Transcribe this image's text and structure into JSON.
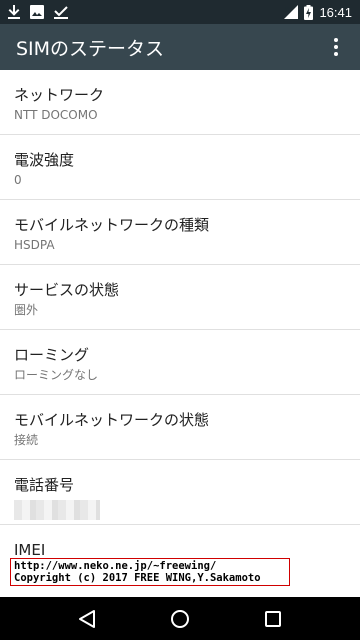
{
  "status_bar": {
    "time": "16:41",
    "signal_label": "H",
    "battery_icon": "battery-charging-icon",
    "left_icons": [
      "download-icon",
      "image-icon",
      "check-icon"
    ]
  },
  "app_bar": {
    "title": "SIMのステータス",
    "overflow_icon": "more-vert-icon",
    "bg_color": "#37474f"
  },
  "items": [
    {
      "title": "ネットワーク",
      "value": "NTT DOCOMO"
    },
    {
      "title": "電波強度",
      "value": "0"
    },
    {
      "title": "モバイルネットワークの種類",
      "value": "HSDPA"
    },
    {
      "title": "サービスの状態",
      "value": "圏外"
    },
    {
      "title": "ローミング",
      "value": "ローミングなし"
    },
    {
      "title": "モバイルネットワークの状態",
      "value": "接続"
    },
    {
      "title": "電話番号",
      "value": ""
    },
    {
      "title": "IMEI",
      "value": ""
    }
  ],
  "watermark": {
    "line1": "http://www.neko.ne.jp/~freewing/",
    "line2": "Copyright (c) 2017 FREE WING,Y.Sakamoto"
  },
  "nav_bar": {
    "back_icon": "back-icon",
    "home_icon": "home-icon",
    "recents_icon": "recents-icon"
  }
}
